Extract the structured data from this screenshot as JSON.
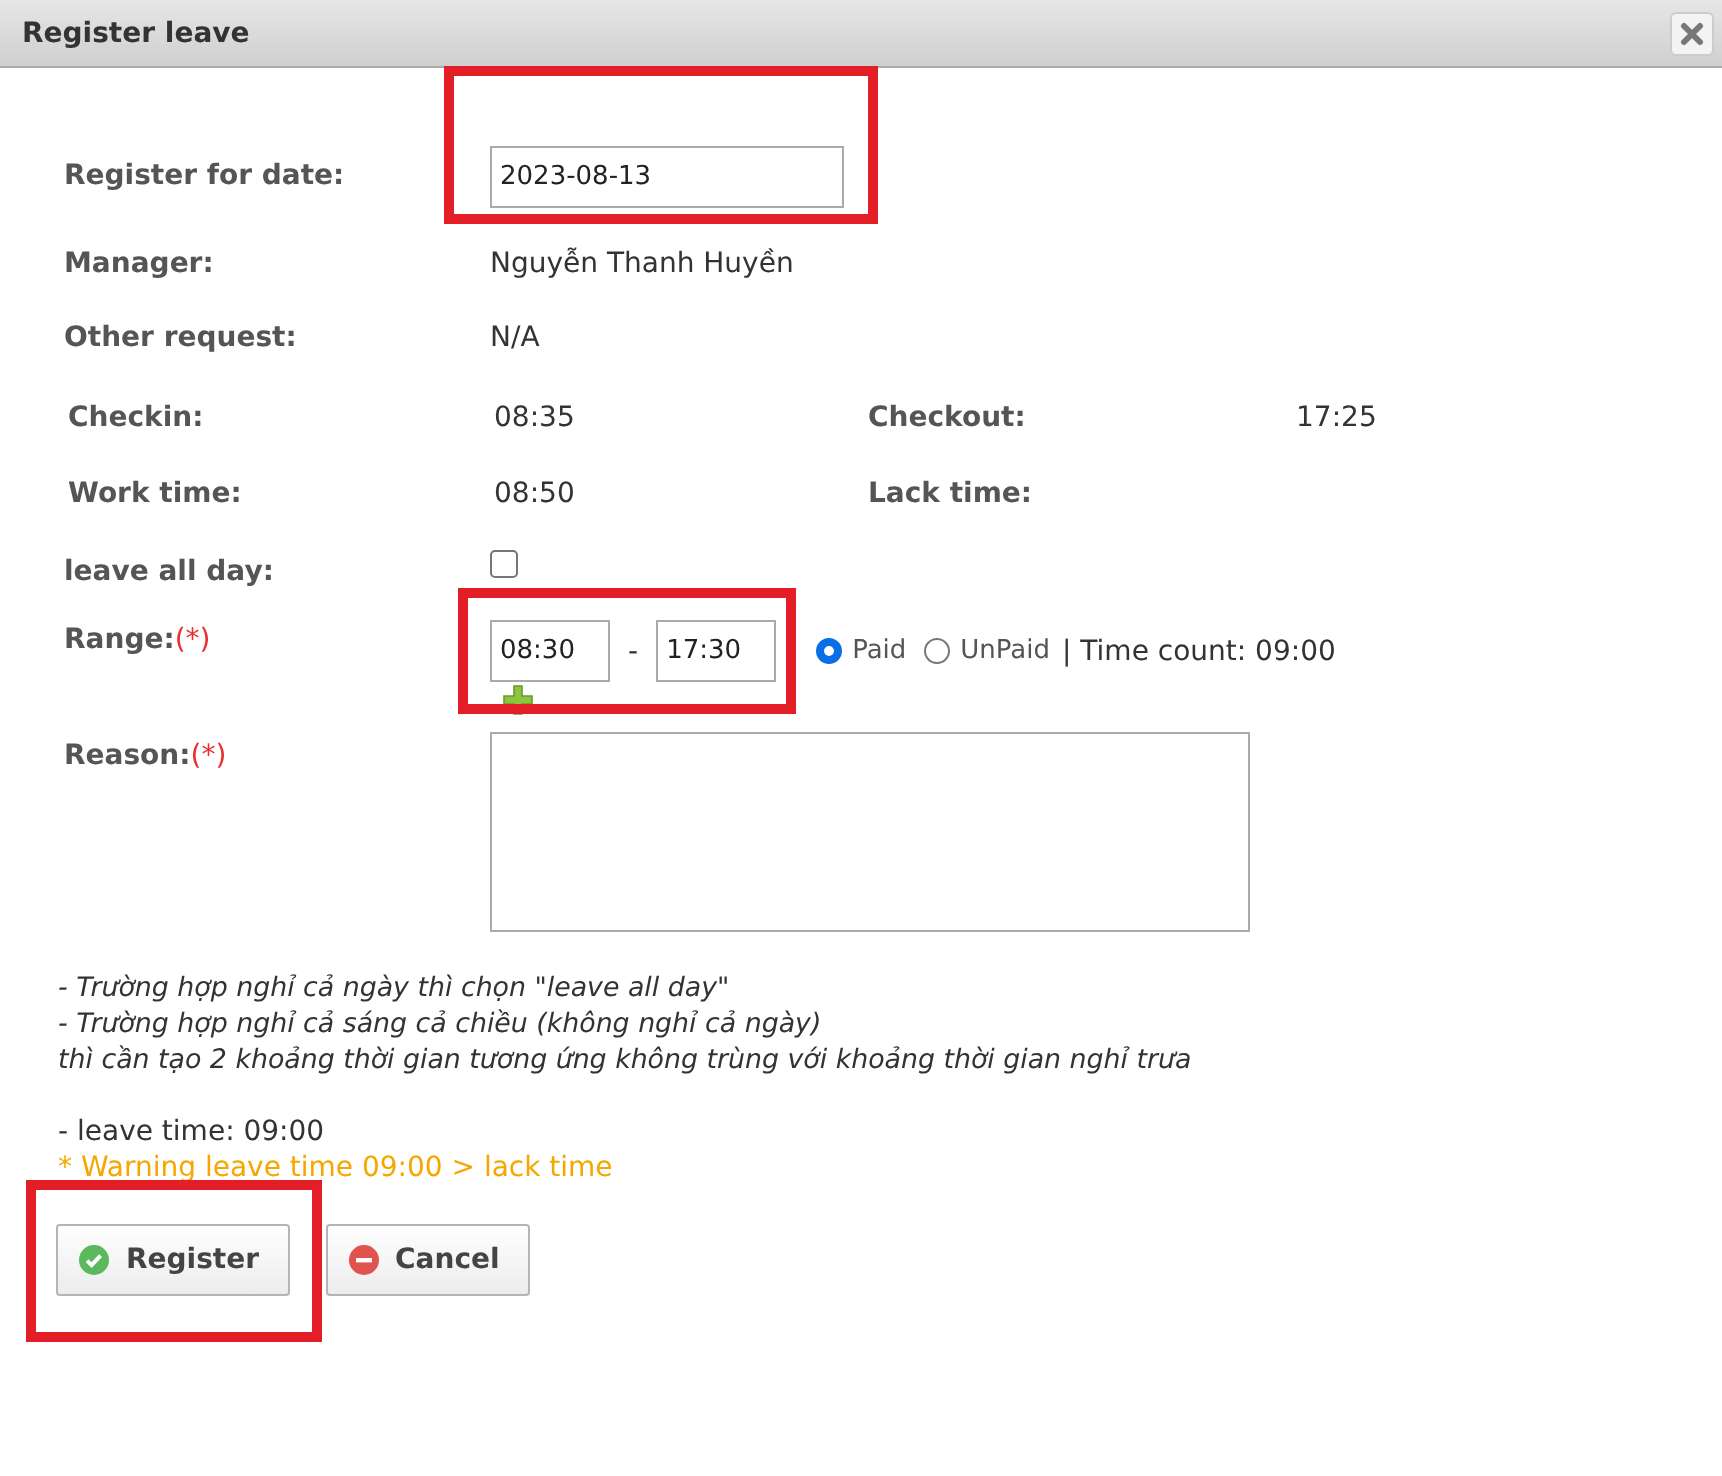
{
  "window": {
    "title": "Register leave"
  },
  "fields": [
    {
      "label": "Register for date:",
      "kind": "input",
      "value": "2023-08-13",
      "highlighted": true
    },
    {
      "label": "Manager:",
      "kind": "text",
      "value": "Nguyễn Thanh Huyền"
    },
    {
      "label": "Other request:",
      "kind": "text",
      "value": "N/A"
    }
  ],
  "times": [
    {
      "label": "Checkin:",
      "value": "08:35"
    },
    {
      "label": "Checkout:",
      "value": "17:25"
    },
    {
      "label": "Work time:",
      "value": "08:50"
    },
    {
      "label": "Lack time:"
    }
  ],
  "leave_all_day": {
    "label": "leave all day:",
    "checked": false
  },
  "range": {
    "label": "Range:",
    "required_mark": "(*)",
    "from": "08:30",
    "separator": "-",
    "to": "17:30",
    "highlighted": true,
    "pay_options": [
      {
        "label": "Paid",
        "selected": true
      },
      {
        "label": "UnPaid",
        "selected": false
      }
    ],
    "time_count": "| Time count: 09:00"
  },
  "reason": {
    "label": "Reason:",
    "required_mark": "(*)"
  },
  "notes": [
    "- Trường hợp nghỉ cả ngày thì chọn \"leave all day\"",
    "- Trường hợp nghỉ cả sáng cả chiều (không nghỉ cả ngày)",
    "thì cần tạo 2 khoảng thời gian tương ứng không trùng với khoảng thời gian nghỉ trưa"
  ],
  "leave_time": "- leave time: 09:00",
  "warning": "* Warning leave time 09:00 > lack time",
  "buttons": [
    {
      "label": "Register",
      "kind": "confirm",
      "highlighted": true
    },
    {
      "label": "Cancel",
      "kind": "cancel",
      "highlighted": false
    }
  ]
}
